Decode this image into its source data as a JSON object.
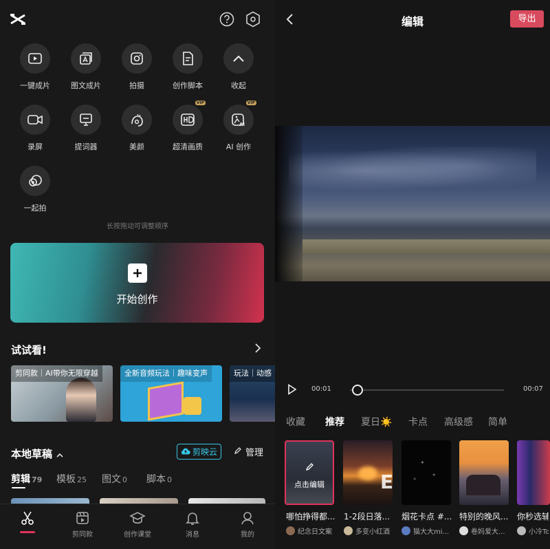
{
  "left": {
    "help_icon": "question-circle-icon",
    "settings_icon": "hexagon-gear-icon",
    "tools": [
      {
        "label": "一键成片",
        "icon": "play-box-icon"
      },
      {
        "label": "图文成片",
        "icon": "image-text-icon"
      },
      {
        "label": "拍摄",
        "icon": "camera-icon"
      },
      {
        "label": "创作脚本",
        "icon": "script-icon"
      },
      {
        "label": "收起",
        "icon": "chevron-up-icon"
      },
      {
        "label": "录屏",
        "icon": "video-record-icon"
      },
      {
        "label": "提词器",
        "icon": "teleprompter-icon"
      },
      {
        "label": "美颜",
        "icon": "beauty-icon"
      },
      {
        "label": "超清画质",
        "icon": "hd-icon",
        "badge": "VIP"
      },
      {
        "label": "AI 创作",
        "icon": "ai-create-icon",
        "badge": "VIP"
      },
      {
        "label": "一起拍",
        "icon": "together-icon"
      }
    ],
    "reorder_hint": "长按拖动可调整顺序",
    "start_button": "开始创作",
    "try_title": "试试看!",
    "try_cards": [
      {
        "title": "剪同款｜AI带你无限穿越"
      },
      {
        "title": "全新音频玩法｜趣味变声"
      },
      {
        "title": "玩法｜动感"
      }
    ],
    "drafts_title": "本地草稿",
    "cloud_button": "剪映云",
    "manage_button": "管理",
    "draft_tabs": [
      {
        "label": "剪辑",
        "count": "79"
      },
      {
        "label": "模板",
        "count": "25"
      },
      {
        "label": "图文",
        "count": "0"
      },
      {
        "label": "脚本",
        "count": "0"
      }
    ],
    "bottom_nav": [
      {
        "label": "",
        "icon": "scissors-icon"
      },
      {
        "label": "剪同款",
        "icon": "clapper-icon"
      },
      {
        "label": "创作课堂",
        "icon": "graduation-cap-icon"
      },
      {
        "label": "消息",
        "icon": "bell-icon"
      },
      {
        "label": "我的",
        "icon": "person-icon"
      }
    ]
  },
  "right": {
    "back_icon": "chevron-left-icon",
    "title": "编辑",
    "export_button": "导出",
    "time_current": "00:01",
    "time_total": "00:07",
    "progress": 0.04,
    "filter_tabs": [
      "收藏",
      "推荐",
      "夏日☀️",
      "卡点",
      "高级感",
      "简单"
    ],
    "edit_card_label": "点击编辑",
    "templates": [
      {
        "title": "哪怕挣得都...",
        "author": "纪念日文案",
        "avatar_color": "#8a6a52"
      },
      {
        "title": "1-2段日落...",
        "author": "多变小红酒",
        "avatar_color": "#c9b89a"
      },
      {
        "title": "烟花卡点 #...",
        "author": "猫大大mi...",
        "avatar_color": "#5a7bbf"
      },
      {
        "title": "特别的晚风...",
        "author": "卷妈爱大...",
        "avatar_color": "#ddd"
      },
      {
        "title": "你秒选辅",
        "author": "小冷To",
        "avatar_color": "#bbb"
      }
    ]
  },
  "colors": {
    "accent": "#e2335c",
    "export": "#d84a5e",
    "cloud": "#37c6e8"
  }
}
